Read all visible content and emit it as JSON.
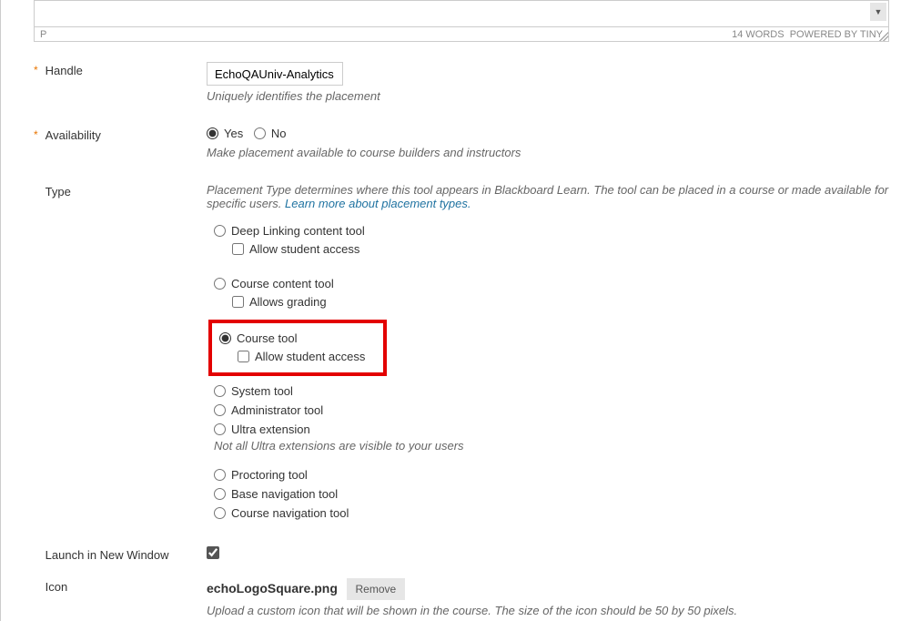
{
  "editor": {
    "path_indicator": "P",
    "word_count": "14 WORDS",
    "powered_by": "POWERED BY TINY"
  },
  "fields": {
    "handle": {
      "label": "Handle",
      "value": "EchoQAUniv-Analytics",
      "help": "Uniquely identifies the placement"
    },
    "availability": {
      "label": "Availability",
      "yes": "Yes",
      "no": "No",
      "help": "Make placement available to course builders and instructors"
    },
    "type": {
      "label": "Type",
      "intro": "Placement Type determines where this tool appears in Blackboard Learn. The tool can be placed in a course or made available for specific users.",
      "learn_more": "Learn more about placement types.",
      "options": {
        "deep_linking": "Deep Linking content tool",
        "deep_linking_sub": "Allow student access",
        "course_content": "Course content tool",
        "course_content_sub": "Allows grading",
        "course_tool": "Course tool",
        "course_tool_sub": "Allow student access",
        "system_tool": "System tool",
        "admin_tool": "Administrator tool",
        "ultra_ext": "Ultra extension",
        "ultra_note": "Not all Ultra extensions are visible to your users",
        "proctoring": "Proctoring tool",
        "base_nav": "Base navigation tool",
        "course_nav": "Course navigation tool"
      }
    },
    "new_window": {
      "label": "Launch in New Window"
    },
    "icon": {
      "label": "Icon",
      "filename": "echoLogoSquare.png",
      "remove": "Remove",
      "help": "Upload a custom icon that will be shown in the course. The size of the icon should be 50 by 50 pixels."
    }
  }
}
